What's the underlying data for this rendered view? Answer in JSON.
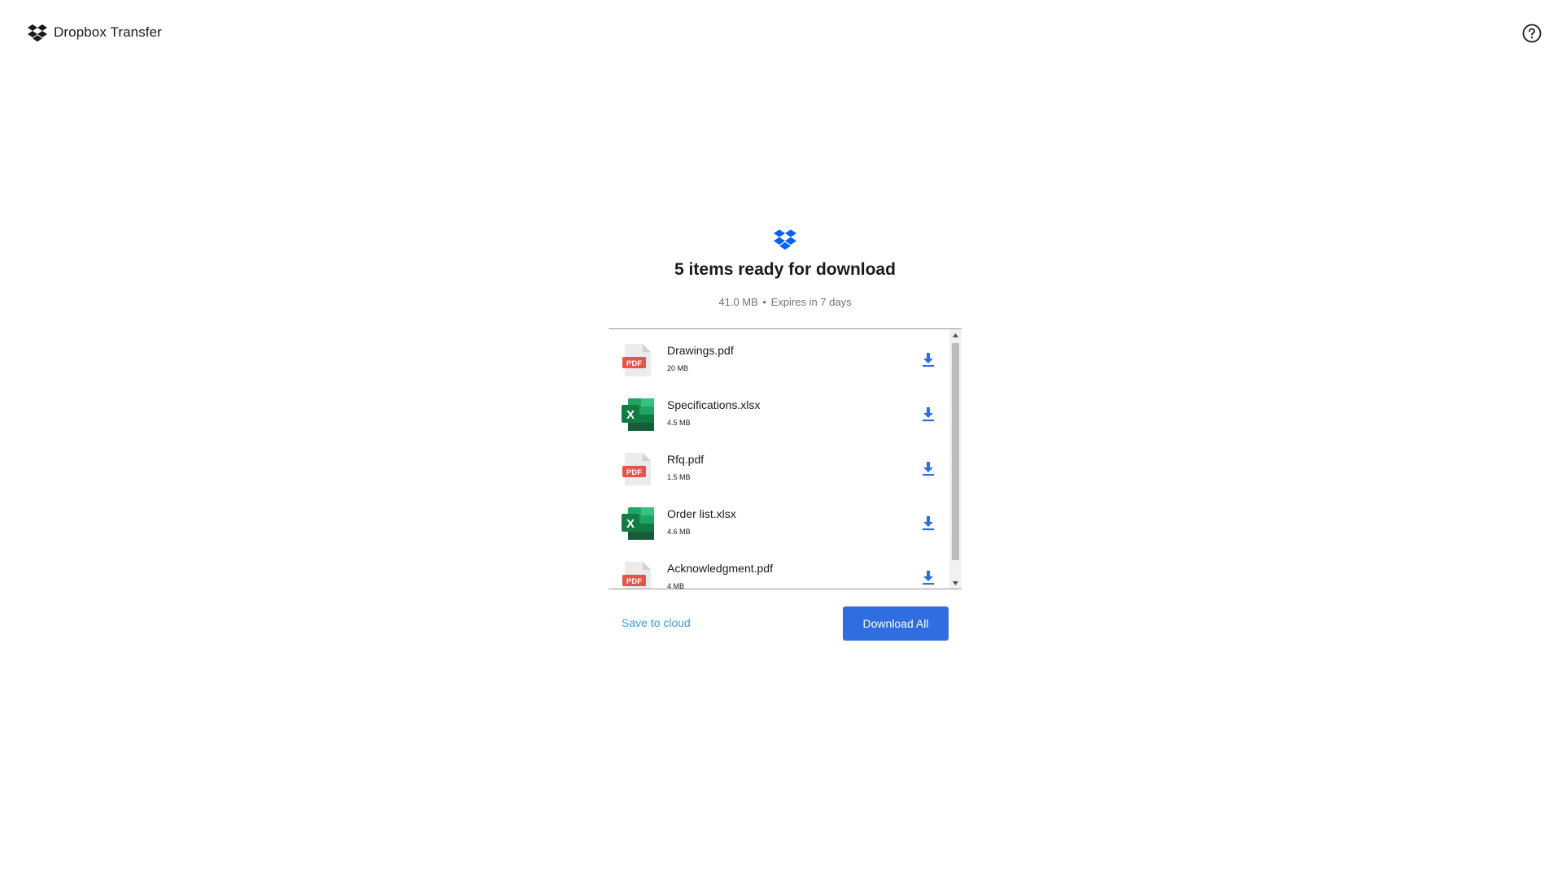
{
  "app": {
    "brand_name": "Dropbox Transfer",
    "brand_icon": "dropbox-logo-icon",
    "help_icon": "help-circle-icon"
  },
  "transfer": {
    "title": "5 items ready for download",
    "size": "41.0 MB",
    "separator": "•",
    "expiry": "Expires in 7 days"
  },
  "files": [
    {
      "name": "Drawings.pdf",
      "size": "20 MB",
      "type": "pdf",
      "icon": "pdf-file-icon"
    },
    {
      "name": "Specifications.xlsx",
      "size": "4.5 MB",
      "type": "xlsx",
      "icon": "excel-file-icon"
    },
    {
      "name": "Rfq.pdf",
      "size": "1.5 MB",
      "type": "pdf",
      "icon": "pdf-file-icon"
    },
    {
      "name": "Order list.xlsx",
      "size": "4.6 MB",
      "type": "xlsx",
      "icon": "excel-file-icon"
    },
    {
      "name": "Acknowledgment.pdf",
      "size": "4 MB",
      "type": "pdf",
      "icon": "pdf-file-icon"
    }
  ],
  "labels": {
    "pdf_badge": "PDF",
    "xlsx_badge": "X"
  },
  "actions": {
    "save_label": "Save to cloud",
    "download_all_label": "Download All"
  },
  "colors": {
    "accent": "#2f6ee0",
    "brand_blue": "#0061fe",
    "link": "#3d9ae8",
    "pdf_red": "#e2574c",
    "excel_green": "#107c41"
  }
}
